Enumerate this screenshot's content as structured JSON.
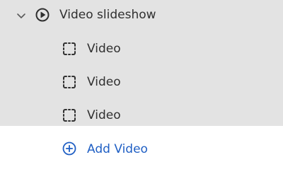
{
  "tree": {
    "parent": {
      "label": "Video slideshow",
      "toggle_icon": "chevron-down-icon",
      "icon": "play-circle-icon",
      "expanded": true
    },
    "children": [
      {
        "label": "Video",
        "icon": "dashed-frame-icon"
      },
      {
        "label": "Video",
        "icon": "dashed-frame-icon"
      },
      {
        "label": "Video",
        "icon": "dashed-frame-icon"
      }
    ],
    "add_action": {
      "label": "Add Video",
      "icon": "plus-circle-icon"
    }
  },
  "colors": {
    "panel_background": "#e3e3e3",
    "add_row_background": "#ffffff",
    "text": "#303030",
    "accent": "#1f5fc4"
  }
}
